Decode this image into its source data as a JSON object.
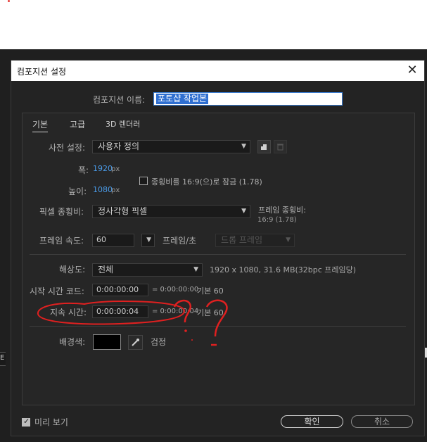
{
  "dialog": {
    "title": "컴포지션 설정",
    "close_glyph": "✕",
    "name_label": "컴포지션 이름:",
    "name_value": "포토샵 작업본",
    "tabs": [
      "기본",
      "고급",
      "3D 렌더러"
    ],
    "preset_label": "사전 설정:",
    "preset_value": "사용자 정의",
    "width_label": "폭:",
    "width_value": "1920",
    "height_label": "높이:",
    "height_value": "1080",
    "unit_px": "px",
    "lock_aspect_label": "종횡비를 16:9(으)로 잠금 (1.78)",
    "pixel_aspect_label": "픽셀 종횡비:",
    "pixel_aspect_value": "정사각형 픽셀",
    "frame_aspect_label": "프레임 종횡비:",
    "frame_aspect_value": "16:9 (1.78)",
    "frame_rate_label": "프레임 속도:",
    "frame_rate_value": "60",
    "frame_rate_unit": "프레임/초",
    "drop_frame_value": "드롭 프레임",
    "resolution_label": "해상도:",
    "resolution_value": "전체",
    "resolution_info": "1920 x 1080, 31.6 MB(32bpc 프레임당)",
    "start_tc_label": "시작 시간 코드:",
    "start_tc_value": "0:00:00:00",
    "start_tc_info": "= 0:00:00:00",
    "start_base": "기본 60",
    "duration_label": "지속 시간:",
    "duration_value": "0:00:00:04",
    "duration_info": "= 0:00:00:04",
    "duration_base": "기본 60",
    "bg_label": "배경색:",
    "bg_name": "검정",
    "bg_color": "#000000",
    "preview_label": "미리 보기",
    "ok_label": "확인",
    "cancel_label": "취소"
  },
  "annotation": {
    "color": "#e02020",
    "text": "??"
  },
  "side_fragments": {
    "left_letter": "E"
  }
}
